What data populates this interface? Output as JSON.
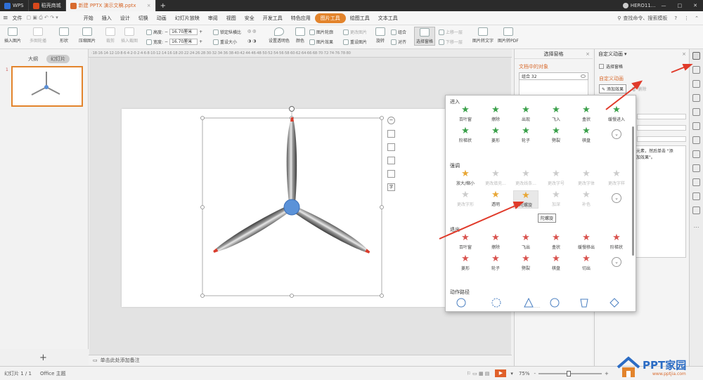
{
  "titlebar": {
    "tabs": [
      {
        "label": "WPS",
        "color": "#2f6fd6"
      },
      {
        "label": "稻壳商城",
        "color": "#d9481c"
      },
      {
        "label": "新建 PPTX 演示文稿.pptx",
        "color": "#d86a2d"
      }
    ],
    "new_tab": "+",
    "account": "HERO11...",
    "icons": [
      "minimize-icon",
      "maximize-icon",
      "close-icon"
    ]
  },
  "menubar": {
    "file": "文件",
    "items": [
      "开始",
      "插入",
      "设计",
      "切换",
      "动画",
      "幻灯片放映",
      "审阅",
      "视图",
      "安全",
      "开发工具",
      "特色应用",
      "图片工具",
      "绘图工具",
      "文本工具"
    ],
    "active": "图片工具",
    "search": "查找命令、搜索模板"
  },
  "ribbon": {
    "insert_picture": "插入图片",
    "multi_crop": "多图轮播",
    "shape": "形状",
    "compress": "压缩图片",
    "crop": "裁剪",
    "insert_crop": "插入截图",
    "height_label": "高度:",
    "height_value": "16.70厘米",
    "width_label": "宽度:",
    "width_value": "16.70厘米",
    "lock_ratio": "锁定纵横比",
    "reset_size": "重设大小",
    "set_transparent": "设置透明色",
    "color": "颜色",
    "outline": "图片轮廓",
    "effects": "图片效果",
    "change_picture": "更改图片",
    "reset_picture": "重设图片",
    "rotate": "旋转",
    "group": "组合",
    "align": "对齐",
    "select_pane": "选择窗格",
    "up_layer": "上移一层",
    "down_layer": "下移一层",
    "to_text": "图片转文字",
    "to_pdf": "图片转PDF"
  },
  "leftpanel": {
    "tabs": [
      "大纲",
      "幻灯片"
    ],
    "active": "幻灯片",
    "slide_number": "1",
    "add_button": "+"
  },
  "selpane": {
    "title": "选择窗格",
    "doc_objects": "文档中的对象",
    "object": "组合 32"
  },
  "anipane": {
    "title": "自定义动画",
    "select_pane": "选择窗格",
    "custom": "自定义动画",
    "add_effect": "添加效果",
    "delete": "删除",
    "hint1": "元素，然后单击 \"添",
    "hint2": "加效果\"。"
  },
  "popup": {
    "entrance": {
      "title": "进入",
      "items": [
        "百叶窗",
        "擦除",
        "出现",
        "飞入",
        "盒状",
        "缓慢进入",
        "阶梯状",
        "菱形",
        "轮子",
        "劈裂",
        "棋盘"
      ]
    },
    "emphasis": {
      "title": "强调",
      "items": [
        {
          "label": "放大/缩小",
          "dim": false
        },
        {
          "label": "更改填充...",
          "dim": true
        },
        {
          "label": "更改线条...",
          "dim": true
        },
        {
          "label": "更改字号",
          "dim": true
        },
        {
          "label": "更改字体",
          "dim": true
        },
        {
          "label": "更改字样",
          "dim": true
        },
        {
          "label": "更改字形",
          "dim": true
        },
        {
          "label": "透明",
          "dim": false
        },
        {
          "label": "陀螺旋",
          "dim": false
        },
        {
          "label": "加深",
          "dim": true
        },
        {
          "label": "补色",
          "dim": true
        }
      ],
      "tooltip": "陀螺旋"
    },
    "exit": {
      "title": "退出",
      "items": [
        "百叶窗",
        "擦除",
        "飞出",
        "盒状",
        "缓慢移出",
        "阶梯状",
        "菱形",
        "轮子",
        "劈裂",
        "棋盘",
        "切出"
      ]
    },
    "paths": {
      "title": "动作路径"
    },
    "more": "⌄"
  },
  "notes": {
    "placeholder": "单击此处添加备注"
  },
  "statusbar": {
    "slide": "幻灯片 1 / 1",
    "theme": "Office 主题",
    "zoom": "75%",
    "minus": "-",
    "plus": "+"
  },
  "watermark": "PPT家园",
  "watermark_sub": "www.pptjia.com",
  "colors": {
    "accent": "#e3842c",
    "title_bg": "#2b2b2b",
    "entrance": "#3aa04a",
    "emphasis": "#e8a736",
    "exit": "#d9534f",
    "arrow": "#e03a2a"
  }
}
